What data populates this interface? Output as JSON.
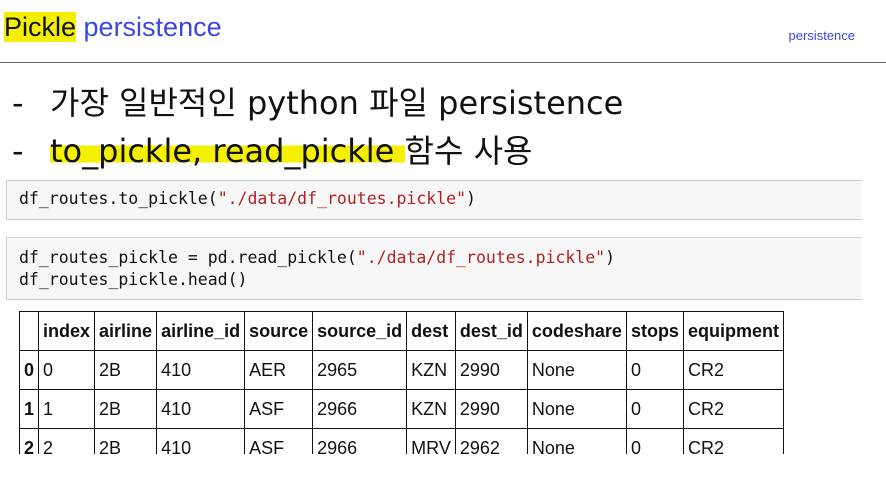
{
  "header": {
    "title_highlight": "Pickle",
    "title_rest": " persistence",
    "section_tag": "persistence"
  },
  "bullets": [
    {
      "dash": "-",
      "text": "가장 일반적인 python 파일 persistence"
    },
    {
      "dash": "-",
      "highlight": "to_pickle, read_pickle ",
      "text": "함수 사용"
    }
  ],
  "code": {
    "cell1": {
      "prefix": "df_routes.to_pickle(",
      "string": "\"./data/df_routes.pickle\"",
      "suffix": ")"
    },
    "cell2_line1": {
      "prefix": "df_routes_pickle = pd.read_pickle(",
      "string": "\"./data/df_routes.pickle\"",
      "suffix": ")"
    },
    "cell2_line2": "df_routes_pickle.head()"
  },
  "table": {
    "corner": "",
    "columns": [
      "index",
      "airline",
      "airline_id",
      "source",
      "source_id",
      "dest",
      "dest_id",
      "codeshare",
      "stops",
      "equipment"
    ],
    "rows": [
      {
        "idx": "0",
        "cells": [
          "0",
          "2B",
          "410",
          "AER",
          "2965",
          "KZN",
          "2990",
          "None",
          "0",
          "CR2"
        ]
      },
      {
        "idx": "1",
        "cells": [
          "1",
          "2B",
          "410",
          "ASF",
          "2966",
          "KZN",
          "2990",
          "None",
          "0",
          "CR2"
        ]
      },
      {
        "idx": "2",
        "cells": [
          "2",
          "2B",
          "410",
          "ASF",
          "2966",
          "MRV",
          "2962",
          "None",
          "0",
          "CR2"
        ]
      }
    ]
  }
}
